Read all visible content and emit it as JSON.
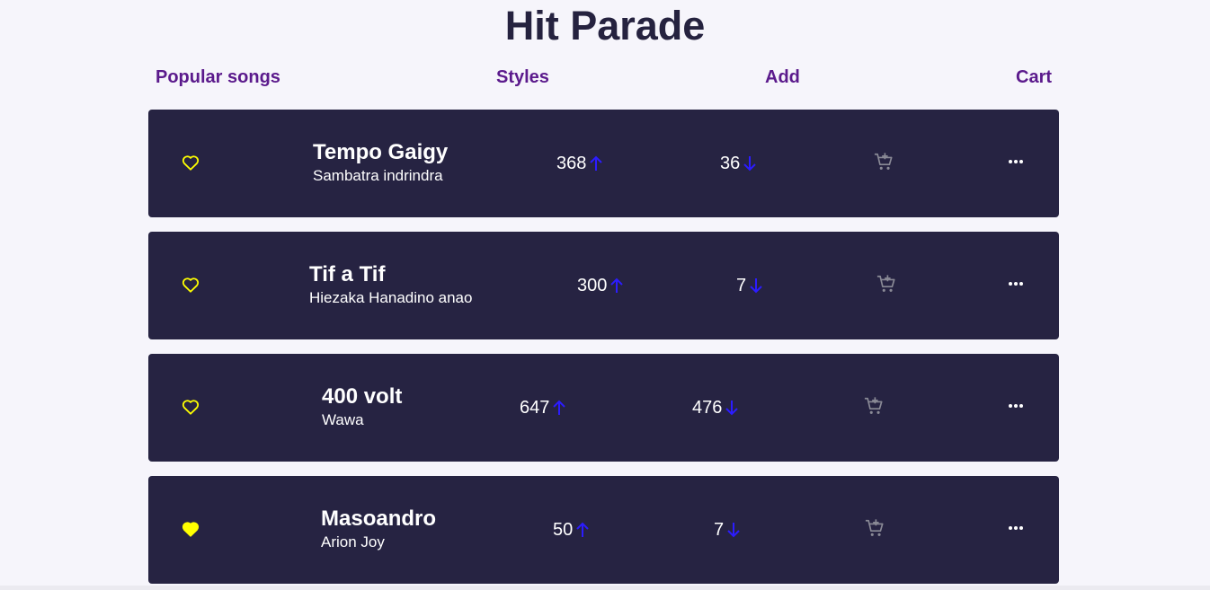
{
  "page": {
    "title": "Hit Parade"
  },
  "nav": {
    "popular": "Popular songs",
    "styles": "Styles",
    "add": "Add",
    "cart": "Cart"
  },
  "colors": {
    "background": "#f6f5fb",
    "card": "#262342",
    "title": "#25223f",
    "nav": "#5b1a8c",
    "heart": "#ffff00",
    "arrow": "#2c1cff",
    "cart_icon": "#8a8a96"
  },
  "songs": [
    {
      "name": "Tempo Gaigy",
      "artist": "Sambatra indrindra",
      "upvotes": "368",
      "downvotes": "36",
      "favorite": false
    },
    {
      "name": "Tif a Tif",
      "artist": "Hiezaka Hanadino anao",
      "upvotes": "300",
      "downvotes": "7",
      "favorite": false
    },
    {
      "name": "400 volt",
      "artist": "Wawa",
      "upvotes": "647",
      "downvotes": "476",
      "favorite": false
    },
    {
      "name": "Masoandro",
      "artist": "Arion Joy",
      "upvotes": "50",
      "downvotes": "7",
      "favorite": true
    }
  ],
  "icons": {
    "heart": "heart-icon",
    "up": "arrow-up-icon",
    "down": "arrow-down-icon",
    "cart": "add-to-cart-icon",
    "more": "more-icon"
  }
}
